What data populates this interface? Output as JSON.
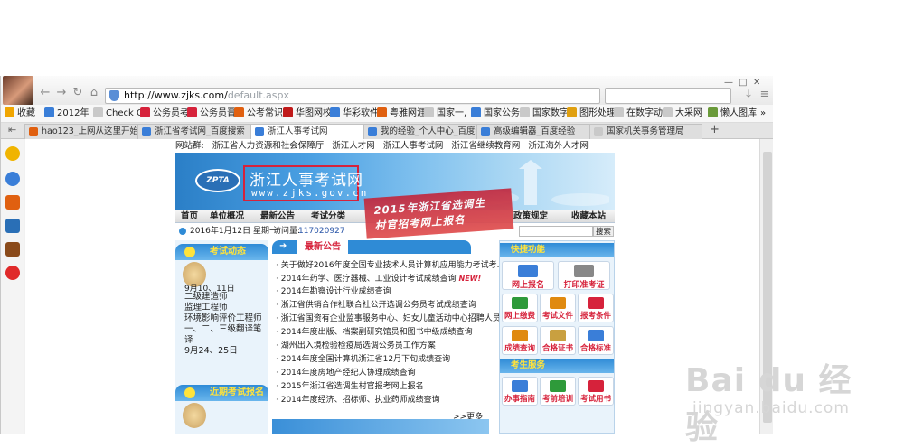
{
  "browser": {
    "url_host": "http://www.zjks.com/",
    "url_path": "default.aspx",
    "window_controls": [
      "—",
      "□",
      "✕"
    ]
  },
  "bookmarks": [
    {
      "label": "收藏",
      "color": "#f0a500"
    },
    {
      "label": "2012年",
      "color": "#3a7ed8"
    },
    {
      "label": "Check O",
      "color": "#c9c9c9"
    },
    {
      "label": "公务员考",
      "color": "#d6223b"
    },
    {
      "label": "公务员晋",
      "color": "#d6223b"
    },
    {
      "label": "公考常识",
      "color": "#e06010"
    },
    {
      "label": "华图网校",
      "color": "#c01a1a"
    },
    {
      "label": "华彩软件",
      "color": "#3a7ed8"
    },
    {
      "label": "粤雅网涯",
      "color": "#e06010"
    },
    {
      "label": "国家一,",
      "color": "#c9c9c9"
    },
    {
      "label": "国家公务",
      "color": "#3a7ed8"
    },
    {
      "label": "国家数字",
      "color": "#c9c9c9"
    },
    {
      "label": "图形处理",
      "color": "#e0a010"
    },
    {
      "label": "在数字动",
      "color": "#c9c9c9"
    },
    {
      "label": "大采网",
      "color": "#c9c9c9"
    },
    {
      "label": "懒人图库",
      "color": "#6a9a3a"
    }
  ],
  "tabs": [
    {
      "label": "hao123_上网从这里开始",
      "color": "#e06010"
    },
    {
      "label": "浙江省考试网_百度搜索",
      "color": "#3a7ed8"
    },
    {
      "label": "浙江人事考试网",
      "color": "#3a7ed8"
    },
    {
      "label": "我的经验_个人中心_百度经",
      "color": "#3a7ed8"
    },
    {
      "label": "高级编辑器_百度经验",
      "color": "#3a7ed8"
    },
    {
      "label": "国家机关事务管理局",
      "color": "#c9c9c9"
    }
  ],
  "site": {
    "links_prefix": "网站群:",
    "links": [
      "浙江省人力资源和社会保障厅",
      "浙江人才网",
      "浙江人事考试网",
      "浙江省继续教育网",
      "浙江海外人才网"
    ],
    "logo_text": "ZPTA",
    "title": "浙江人事考试网",
    "title_url": "www.zjks.gov.cn",
    "menu": [
      "首页",
      "单位概况",
      "最新公告",
      "考试分类",
      "政策规定",
      "收藏本站"
    ],
    "promo_line1": "2015年浙江省选调生",
    "promo_line2": "村官招考网上报名",
    "date": "2016年1月12日 星期一",
    "visits_label": "访问量:",
    "visits": "117020927",
    "search_btn": "搜索",
    "left_header": "考试动态",
    "left_dates": "9月10、11日",
    "left_items": [
      "二级建造师",
      "监理工程师",
      "环境影响评价工程师",
      "一、二、三级翻译笔译",
      "9月24、25日"
    ],
    "left_header2": "近期考试报名",
    "news_header": "最新公告",
    "news": [
      {
        "text": "关于做好2016年度全国专业技术人员计算机应用能力考试考...",
        "new": true
      },
      {
        "text": "2014年药学、医疗器械、工业设计考试成绩查询",
        "new": true
      },
      {
        "text": "2014年勘察设计行业成绩查询",
        "new": false
      },
      {
        "text": "浙江省供销合作社联合社公开选调公务员考试成绩查询",
        "new": false
      },
      {
        "text": "浙江省国资有企业监事服务中心、妇女儿童活动中心招聘人员考...",
        "new": false
      },
      {
        "text": "2014年度出版、档案副研究馆员和图书中级成绩查询",
        "new": false
      },
      {
        "text": "湖州出入境检验检疫局选调公务员工作方案",
        "new": false
      },
      {
        "text": "2014年度全国计算机浙江省12月下旬成绩查询",
        "new": false
      },
      {
        "text": "2014年度房地产经纪人协理成绩查询",
        "new": false
      },
      {
        "text": "2015年浙江省选调生村官报考网上报名",
        "new": false
      },
      {
        "text": "2014年度经济、招标师、执业药师成绩查询",
        "new": false
      }
    ],
    "new_badge": "NEW!",
    "more": ">>更多",
    "quick_header": "快捷功能",
    "quick_big": [
      "网上报名",
      "打印准考证"
    ],
    "quick_small": [
      "网上缴费",
      "考试文件",
      "报考条件",
      "成绩查询",
      "合格证书",
      "合格标准"
    ],
    "service_header": "考生服务",
    "service": [
      "办事指南",
      "考前培训",
      "考试用书"
    ]
  },
  "watermark": {
    "big": "Bai du 经验",
    "small": "jingyan.baidu.com"
  }
}
